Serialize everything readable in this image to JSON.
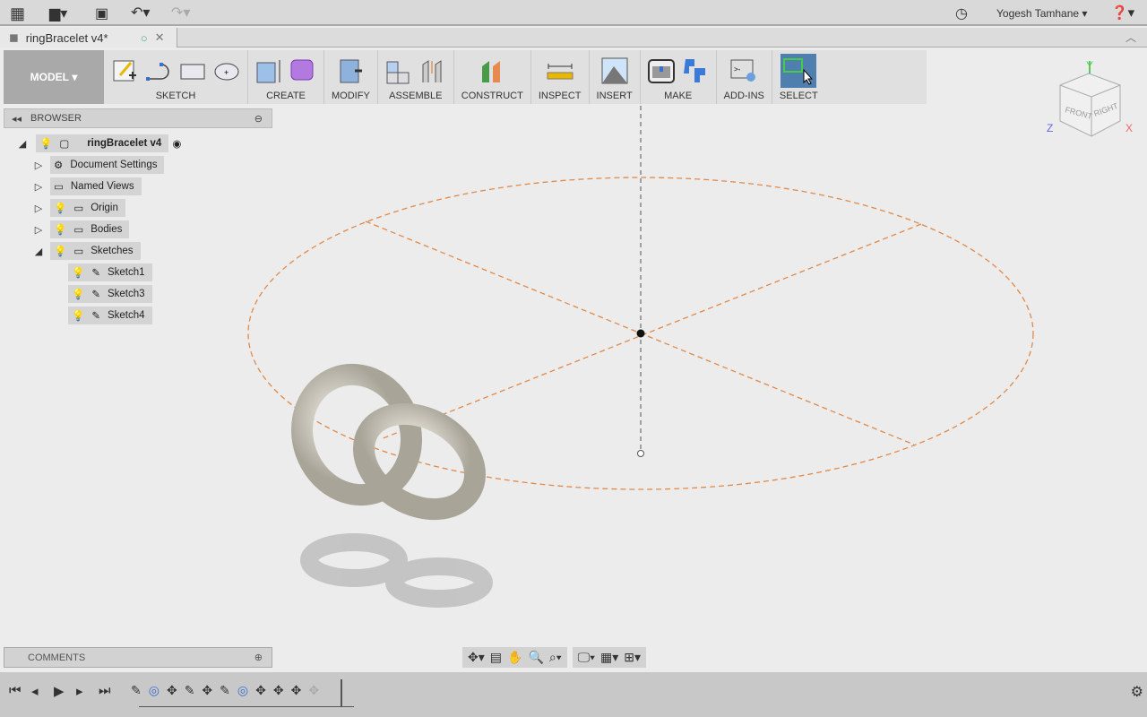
{
  "app": {
    "user": "Yogesh Tamhane"
  },
  "tab": {
    "title": "ringBracelet v4*"
  },
  "toolbar": {
    "workspace": "MODEL",
    "groups": [
      {
        "label": "SKETCH",
        "icons": [
          "create-sketch-icon",
          "arc-icon",
          "rectangle-icon",
          "circle-icon"
        ]
      },
      {
        "label": "CREATE",
        "icons": [
          "extrude-icon",
          "form-icon"
        ]
      },
      {
        "label": "MODIFY",
        "icons": [
          "press-pull-icon"
        ]
      },
      {
        "label": "ASSEMBLE",
        "icons": [
          "new-component-icon",
          "joint-icon"
        ]
      },
      {
        "label": "CONSTRUCT",
        "icons": [
          "plane-icon"
        ]
      },
      {
        "label": "INSPECT",
        "icons": [
          "measure-icon"
        ]
      },
      {
        "label": "INSERT",
        "icons": [
          "insert-image-icon"
        ]
      },
      {
        "label": "MAKE",
        "icons": [
          "3d-print-icon",
          "cam-icon"
        ]
      },
      {
        "label": "ADD-INS",
        "icons": [
          "scripts-icon"
        ]
      },
      {
        "label": "SELECT",
        "icons": [
          "select-icon"
        ]
      }
    ]
  },
  "browser": {
    "title": "BROWSER",
    "root": "ringBracelet v4",
    "items": [
      {
        "label": "Document Settings"
      },
      {
        "label": "Named Views"
      },
      {
        "label": "Origin"
      },
      {
        "label": "Bodies"
      },
      {
        "label": "Sketches"
      }
    ],
    "sketches": [
      "Sketch1",
      "Sketch3",
      "Sketch4"
    ]
  },
  "comments": {
    "title": "COMMENTS"
  },
  "viewcube": {
    "front": "FRONT",
    "right": "RIGHT",
    "x": "X",
    "y": "Y",
    "z": "Z"
  },
  "colors": {
    "sketch_line": "#e08a4a",
    "select_active": "#4f7fae",
    "model_bg": "#a9a9a9"
  }
}
